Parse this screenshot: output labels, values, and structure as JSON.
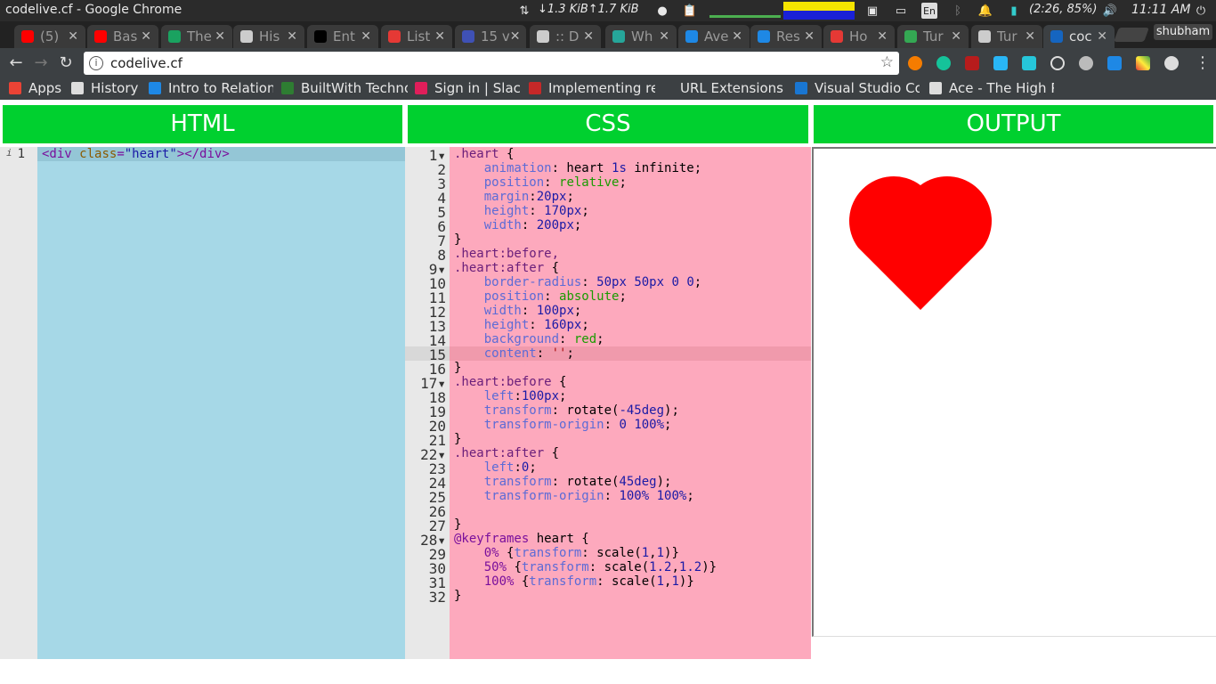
{
  "os": {
    "window_title": "codelive.cf - Google Chrome",
    "net_speed": "↓1.3 KiB↑1.7 KiB",
    "battery": "(2:26, 85%)",
    "clock": "11:11 AM",
    "lang": "En"
  },
  "tabs": [
    {
      "label": "(5)",
      "color": "#ff0000"
    },
    {
      "label": "Bas",
      "color": "#ff0000"
    },
    {
      "label": "The",
      "color": "#1aa260"
    },
    {
      "label": "His",
      "color": "#cccccc"
    },
    {
      "label": "Ent",
      "color": "#000000"
    },
    {
      "label": "List",
      "color": "#e53935"
    },
    {
      "label": "15 v",
      "color": "#3f51b5"
    },
    {
      "label": ":: D",
      "color": "#cccccc"
    },
    {
      "label": "Wh",
      "color": "#26a69a"
    },
    {
      "label": "Ave",
      "color": "#1e88e5"
    },
    {
      "label": "Res",
      "color": "#1e88e5"
    },
    {
      "label": "Ho",
      "color": "#e53935"
    },
    {
      "label": "Tur",
      "color": "#34a853"
    },
    {
      "label": "Tur",
      "color": "#cccccc"
    },
    {
      "label": "coc",
      "color": "#1565c0",
      "active": true
    }
  ],
  "profile": "shubham",
  "omnibox": {
    "url": "codelive.cf"
  },
  "bookmarks": [
    {
      "label": "Apps",
      "color": "#ea4335"
    },
    {
      "label": "History",
      "color": "#dddddd"
    },
    {
      "label": "Intro to Relation",
      "color": "#1e88e5"
    },
    {
      "label": "BuiltWith Techno",
      "color": "#2e7d32"
    },
    {
      "label": "Sign in | Slack",
      "color": "#e01e5a"
    },
    {
      "label": "Implementing re",
      "color": "#c62828"
    },
    {
      "label": "URL Extensions -",
      "color": "#3c4043"
    },
    {
      "label": "Visual Studio Co",
      "color": "#1976d2"
    },
    {
      "label": "Ace - The High Pe",
      "color": "#dddddd"
    }
  ],
  "panes": {
    "html_title": "HTML",
    "css_title": "CSS",
    "output_title": "OUTPUT"
  },
  "html_editor": {
    "gutter_marker": "i",
    "lines": [
      "<div class=\"heart\"></div>"
    ]
  },
  "css_editor": {
    "active_line": 15,
    "lines": [
      ".heart {",
      "    animation: heart 1s infinite;",
      "    position: relative;",
      "    margin:20px;",
      "    height: 170px;",
      "    width: 200px;",
      "}",
      ".heart:before,",
      ".heart:after {",
      "    border-radius: 50px 50px 0 0;",
      "    position: absolute;",
      "    width: 100px;",
      "    height: 160px;",
      "    background: red;",
      "    content: '';",
      "}",
      ".heart:before {",
      "    left:100px;",
      "    transform: rotate(-45deg);",
      "    transform-origin: 0 100%;",
      "}",
      ".heart:after {",
      "    left:0;",
      "    transform: rotate(45deg);",
      "    transform-origin: 100% 100%;",
      "",
      "}",
      "@keyframes heart {",
      "    0% {transform: scale(1,1)}",
      "    50% {transform: scale(1.2,1.2)}",
      "    100% {transform: scale(1,1)}",
      "}"
    ],
    "fold_lines": [
      1,
      9,
      17,
      22,
      28
    ]
  },
  "output": {
    "shape": "heart-icon",
    "color": "#ff0000"
  }
}
